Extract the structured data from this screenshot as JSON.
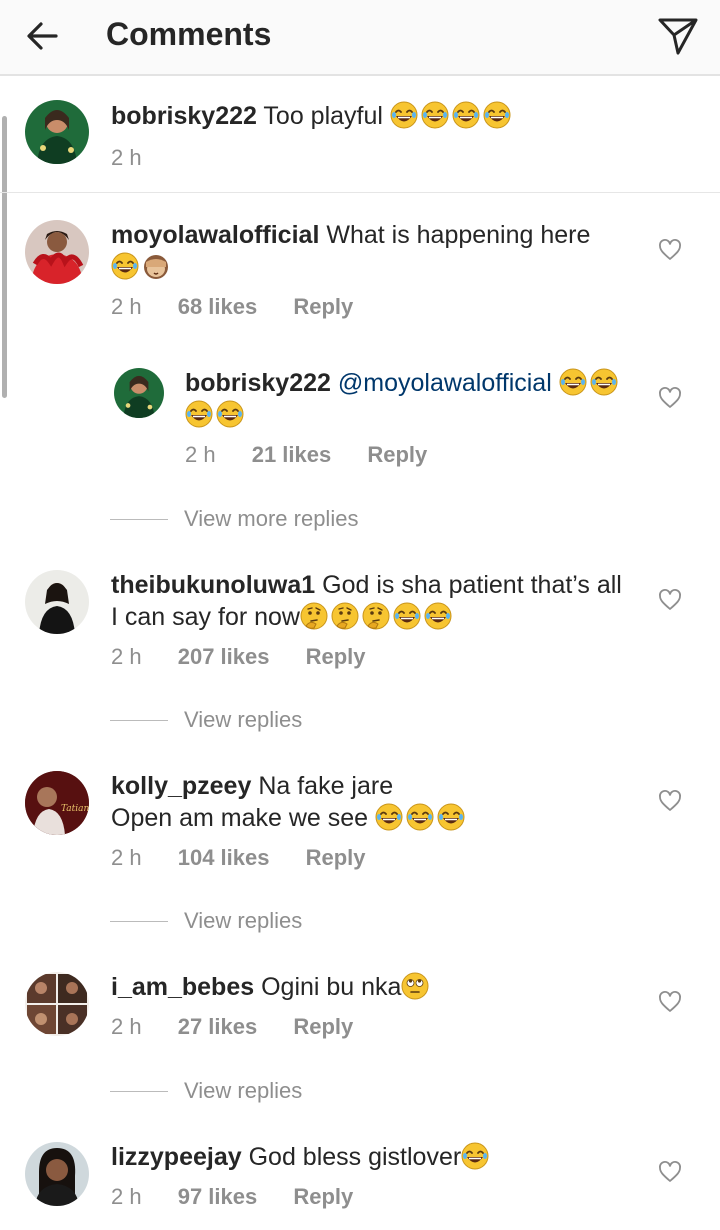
{
  "header": {
    "title": "Comments",
    "back_icon": "arrow-left-icon",
    "share_icon": "send-icon"
  },
  "caption": {
    "username": "bobrisky222",
    "text": "Too playful",
    "emojis": [
      "joy",
      "joy",
      "joy",
      "joy"
    ],
    "time": "2 h"
  },
  "comments": [
    {
      "username": "moyolawalofficial",
      "text": "What is happening here",
      "emojis": [
        "joy",
        "see-no-evil"
      ],
      "time": "2 h",
      "likes": "68 likes",
      "reply_label": "Reply"
    },
    {
      "username": "bobrisky222",
      "mention": "@moyolawalofficial",
      "emojis": [
        "joy",
        "joy",
        "joy",
        "joy"
      ],
      "time": "2 h",
      "likes": "21 likes",
      "reply_label": "Reply"
    },
    {
      "username": "theibukunoluwa1",
      "text": "God is sha patient that’s all I can say for now",
      "emojis": [
        "thinking",
        "thinking",
        "thinking",
        "joy",
        "joy"
      ],
      "time": "2 h",
      "likes": "207 likes",
      "reply_label": "Reply"
    },
    {
      "username": "kolly_pzeey",
      "text": "Na fake jare",
      "text2": "Open am make we see",
      "emojis": [
        "joy",
        "joy",
        "joy"
      ],
      "time": "2 h",
      "likes": "104 likes",
      "reply_label": "Reply"
    },
    {
      "username": "i_am_bebes",
      "text": "Ogini bu nka",
      "emojis": [
        "eye-roll"
      ],
      "time": "2 h",
      "likes": "27 likes",
      "reply_label": "Reply"
    },
    {
      "username": "lizzypeejay",
      "text": "God bless gistlover",
      "emojis": [
        "joy"
      ],
      "time": "2 h",
      "likes": "97 likes",
      "reply_label": "Reply"
    }
  ],
  "view_more_replies": "View more replies",
  "view_replies": "View replies",
  "colors": {
    "username": "#262626",
    "meta": "#8e8e8e",
    "mention": "#00376b",
    "emoji": "#f7c531"
  }
}
